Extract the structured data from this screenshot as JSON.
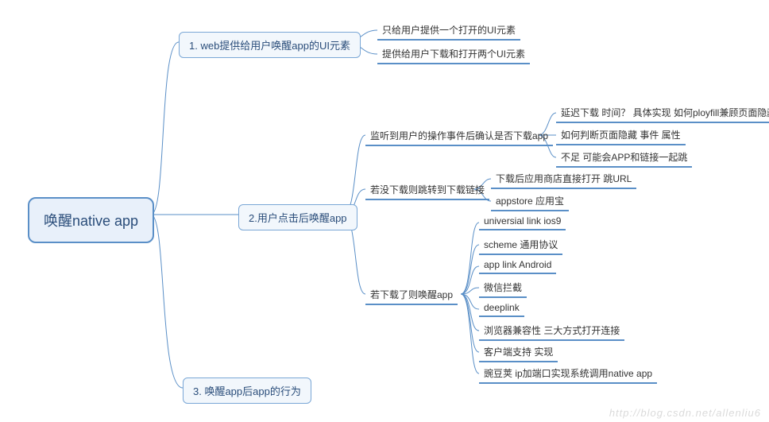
{
  "root": {
    "title": "唤醒native app"
  },
  "branch1": {
    "title": "1. web提供给用户唤醒app的UI元素",
    "leaves": [
      "只给用户提供一个打开的UI元素",
      "提供给用户下载和打开两个UI元素"
    ]
  },
  "branch2": {
    "title": "2.用户点击后唤醒app",
    "sub1": {
      "title": "监听到用户的操作事件后确认是否下载app",
      "leaves": [
        "延迟下载 时间？ 具体实现  如何ployfill兼顾页面隐藏",
        "如何判断页面隐藏  事件 属性",
        "不足  可能会APP和链接一起跳"
      ]
    },
    "sub2": {
      "title": "若没下载则跳转到下载链接",
      "leaves": [
        "下载后应用商店直接打开 跳URL",
        "appstore 应用宝"
      ]
    },
    "sub3": {
      "title": "若下载了则唤醒app",
      "leaves": [
        "universial link  ios9",
        "scheme 通用协议",
        "app link  Android",
        "微信拦截",
        "deeplink",
        "浏览器兼容性  三大方式打开连接",
        "客户端支持  实现",
        "豌豆荚 ip加端口实现系统调用native app"
      ]
    }
  },
  "branch3": {
    "title": "3. 唤醒app后app的行为"
  },
  "watermark": "http://blog.csdn.net/allenliu6"
}
